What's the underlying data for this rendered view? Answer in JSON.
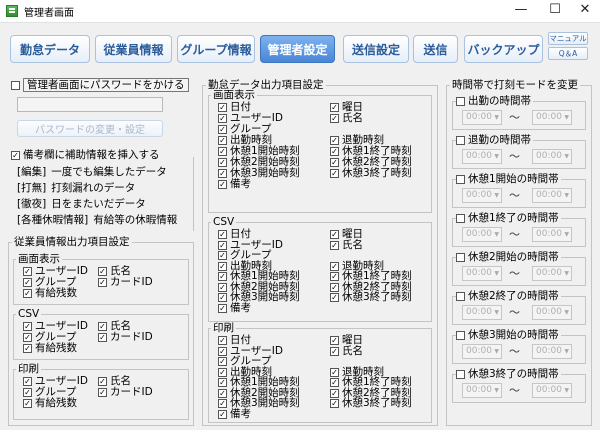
{
  "window": {
    "title": "管理者画面",
    "minimize": "—",
    "maximize": "☐",
    "close": "✕"
  },
  "toolbar": {
    "kintai": "勤怠データ",
    "jugyoin": "従業員情報",
    "group": "グループ情報",
    "kanri": "管理者設定",
    "soshin_settei": "送信設定",
    "soshin": "送信",
    "backup": "バックアップ",
    "manual": "マニュアル",
    "qa": "Q＆A"
  },
  "password": {
    "checkbox_label": "管理者画面にパスワードをかける",
    "value": "",
    "change_button": "パスワードの変更・設定"
  },
  "remarks": {
    "checkbox_label": "備考欄に補助情報を挿入する",
    "items": [
      {
        "key": "[編集]",
        "desc": "一度でも編集したデータ"
      },
      {
        "key": "[打無]",
        "desc": "打刻漏れのデータ"
      },
      {
        "key": "[徹夜]",
        "desc": "日をまたいだデータ"
      },
      {
        "key": "[各種休暇情報]",
        "desc": "有給等の休暇情報"
      }
    ]
  },
  "employee_output": {
    "title": "従業員情報出力項目設定",
    "sections": [
      {
        "title": "画面表示",
        "items": [
          "ユーザーID",
          "氏名",
          "グループ",
          "カードID",
          "有給残数"
        ]
      },
      {
        "title": "CSV",
        "items": [
          "ユーザーID",
          "氏名",
          "グループ",
          "カードID",
          "有給残数"
        ]
      },
      {
        "title": "印刷",
        "items": [
          "ユーザーID",
          "氏名",
          "グループ",
          "カードID",
          "有給残数"
        ]
      }
    ]
  },
  "attendance_output": {
    "title": "勤怠データ出力項目設定",
    "sections": [
      {
        "title": "画面表示",
        "left": [
          "日付",
          "ユーザーID",
          "グループ",
          "出勤時刻",
          "休憩1開始時刻",
          "休憩2開始時刻",
          "休憩3開始時刻",
          "備考"
        ],
        "right": [
          "曜日",
          "氏名",
          "",
          "退勤時刻",
          "休憩1終了時刻",
          "休憩2終了時刻",
          "休憩3終了時刻"
        ]
      },
      {
        "title": "CSV",
        "left": [
          "日付",
          "ユーザーID",
          "グループ",
          "出勤時刻",
          "休憩1開始時刻",
          "休憩2開始時刻",
          "休憩3開始時刻",
          "備考"
        ],
        "right": [
          "曜日",
          "氏名",
          "",
          "退勤時刻",
          "休憩1終了時刻",
          "休憩2終了時刻",
          "休憩3終了時刻"
        ]
      },
      {
        "title": "印刷",
        "left": [
          "日付",
          "ユーザーID",
          "グループ",
          "出勤時刻",
          "休憩1開始時刻",
          "休憩2開始時刻",
          "休憩3開始時刻",
          "備考"
        ],
        "right": [
          "曜日",
          "氏名",
          "",
          "退勤時刻",
          "休憩1終了時刻",
          "休憩2終了時刻",
          "休憩3終了時刻"
        ]
      }
    ]
  },
  "time_mode": {
    "title": "時間帯で打刻モードを変更",
    "slots": [
      {
        "label": "出勤の時間帯",
        "from": "00:00",
        "to": "00:00"
      },
      {
        "label": "退勤の時間帯",
        "from": "00:00",
        "to": "00:00"
      },
      {
        "label": "休憩1開始の時間帯",
        "from": "00:00",
        "to": "00:00"
      },
      {
        "label": "休憩1終了の時間帯",
        "from": "00:00",
        "to": "00:00"
      },
      {
        "label": "休憩2開始の時間帯",
        "from": "00:00",
        "to": "00:00"
      },
      {
        "label": "休憩2終了の時間帯",
        "from": "00:00",
        "to": "00:00"
      },
      {
        "label": "休憩3開始の時間帯",
        "from": "00:00",
        "to": "00:00"
      },
      {
        "label": "休憩3終了の時間帯",
        "from": "00:00",
        "to": "00:00"
      }
    ],
    "tilde": "〜"
  }
}
